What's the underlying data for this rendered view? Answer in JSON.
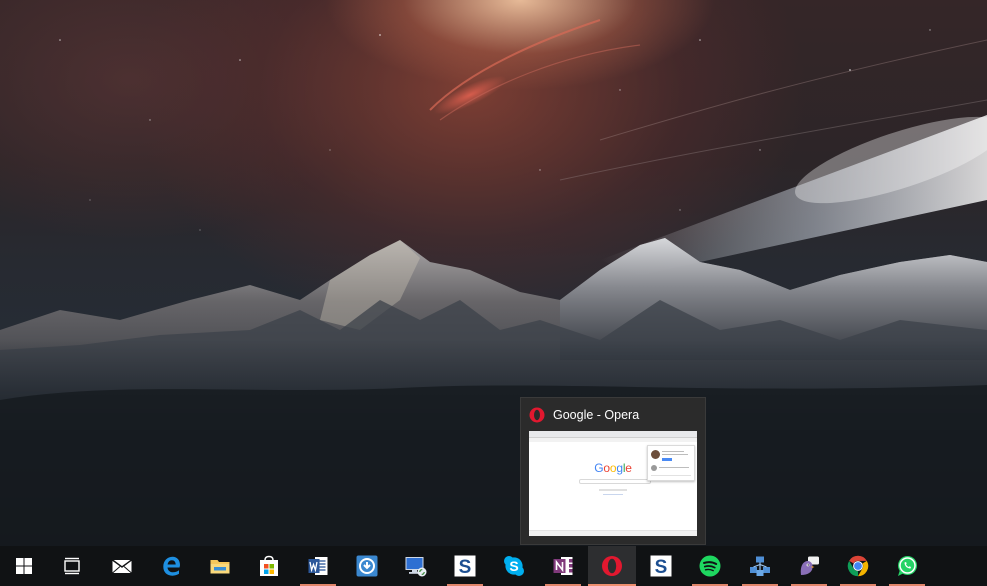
{
  "desktop": {
    "wallpaper": "space-mountains-wallpaper"
  },
  "preview": {
    "app_icon": "opera-icon",
    "title": "Google - Opera",
    "thumbnail": {
      "logo_text": "Google"
    }
  },
  "colors": {
    "taskbar_bg": "#101214",
    "active_indicator": "#ee8f6f",
    "preview_bg": "#2b2b2b"
  },
  "taskbar": {
    "items": [
      {
        "icon": "windows-start-icon",
        "running": false
      },
      {
        "icon": "task-view-icon",
        "running": false
      },
      {
        "icon": "mail-icon",
        "running": false
      },
      {
        "icon": "edge-icon",
        "running": false
      },
      {
        "icon": "file-explorer-icon",
        "running": false
      },
      {
        "icon": "store-icon",
        "running": false
      },
      {
        "icon": "word-icon",
        "running": true
      },
      {
        "icon": "lastpass-icon",
        "running": false
      },
      {
        "icon": "remote-desktop-icon",
        "running": false
      },
      {
        "icon": "skype-business-icon",
        "running": true
      },
      {
        "icon": "skype-icon",
        "running": false
      },
      {
        "icon": "onenote-icon",
        "running": true
      },
      {
        "icon": "opera-icon",
        "running": true,
        "active": true
      },
      {
        "icon": "simplenote-icon",
        "running": false
      },
      {
        "icon": "spotify-icon",
        "running": true
      },
      {
        "icon": "network-icon",
        "running": true
      },
      {
        "icon": "chat-bird-icon",
        "running": true
      },
      {
        "icon": "chrome-icon",
        "running": true
      },
      {
        "icon": "whatsapp-icon",
        "running": true
      }
    ]
  }
}
